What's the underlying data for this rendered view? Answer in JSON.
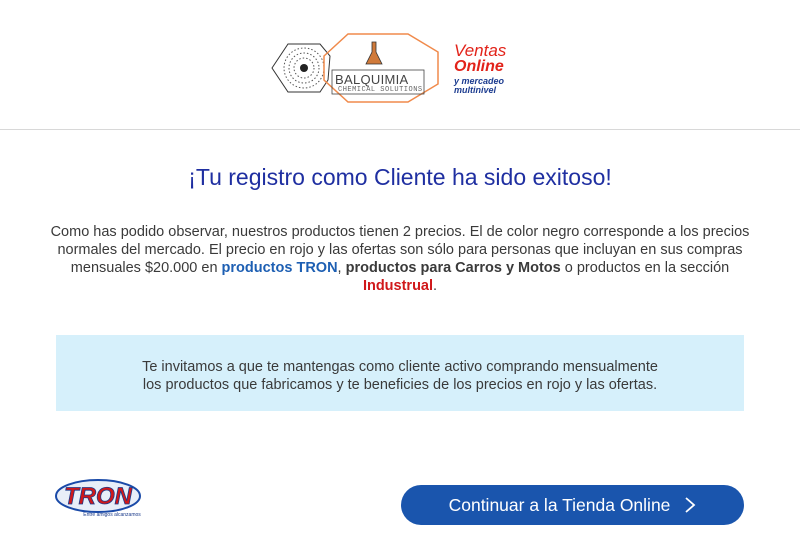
{
  "header": {
    "logo_text": "BALQUIMIA",
    "logo_subtitle": "CHEMICAL SOLUTIONS",
    "promo": {
      "line1": "Ventas",
      "line2": "Online",
      "line3": "y mercadeo",
      "line4": "multinivel"
    }
  },
  "main": {
    "title": "¡Tu registro como Cliente ha sido exitoso!",
    "paragraph": {
      "part1": "Como has podido observar, nuestros productos tienen 2 precios. El de color negro corresponde a los precios normales del mercado. El precio en rojo y las ofertas son sólo para personas que incluyan en sus compras mensuales $20.000 en ",
      "link_tron": "productos TRON",
      "part2": ", ",
      "link_carros": "productos para Carros y Motos",
      "part3": " o productos en la sección ",
      "link_industrial": "Industrual",
      "part4": "."
    },
    "notice": {
      "line1": "Te invitamos a que te mantengas como cliente activo comprando mensualmente",
      "line2": "los productos que fabricamos y te beneficies de los precios en rojo y las ofertas."
    }
  },
  "footer": {
    "tron_logo_text": "TRON",
    "tron_tagline": "Entre amigos alcanzamos",
    "cta_label": "Continuar a la Tienda Online",
    "cta_icon": "chevron-right-icon"
  },
  "colors": {
    "title": "#1f2fa1",
    "cta_bg": "#1a55ad",
    "notice_bg": "#d6f0fb",
    "accent_red": "#d0181a",
    "accent_blue": "#1d5fb3"
  }
}
